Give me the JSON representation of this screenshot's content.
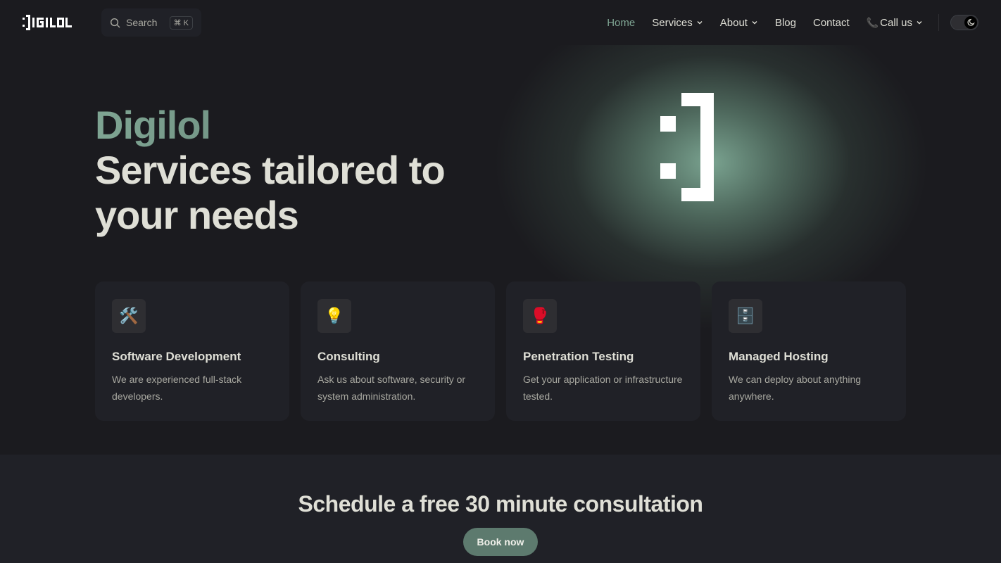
{
  "brand": {
    "name": "DIGILOL"
  },
  "search": {
    "label": "Search",
    "shortcut": "⌘ K"
  },
  "nav": {
    "items": [
      {
        "label": "Home"
      },
      {
        "label": "Services"
      },
      {
        "label": "About"
      },
      {
        "label": "Blog"
      },
      {
        "label": "Contact"
      },
      {
        "label": "Call us"
      }
    ]
  },
  "hero": {
    "name": "Digilol",
    "tagline": "Services tailored to your needs"
  },
  "features": [
    {
      "icon": "🛠️",
      "icon_name": "hammer-wrench-icon",
      "title": "Software Development",
      "text": "We are experienced full-stack developers."
    },
    {
      "icon": "💡",
      "icon_name": "lightbulb-icon",
      "title": "Consulting",
      "text": "Ask us about software, security or system administration."
    },
    {
      "icon": "🥊",
      "icon_name": "boxing-glove-icon",
      "title": "Penetration Testing",
      "text": "Get your application or infrastructure tested."
    },
    {
      "icon": "🗄️",
      "icon_name": "file-cabinet-icon",
      "title": "Managed Hosting",
      "text": "We can deploy about anything anywhere."
    }
  ],
  "cta": {
    "title": "Schedule a free 30 minute consultation",
    "button": "Book now"
  },
  "colors": {
    "accent": "#7fa593",
    "button": "#5d7a6e",
    "background": "#1b1b1f",
    "surface": "#202127"
  }
}
